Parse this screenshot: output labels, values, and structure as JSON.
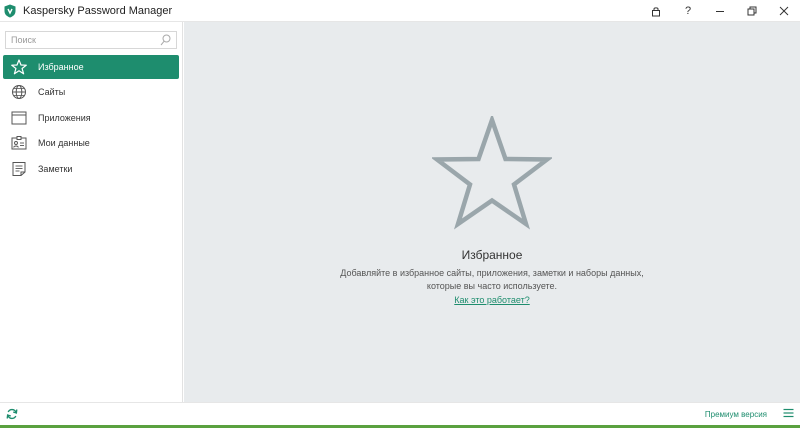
{
  "window": {
    "title": "Kaspersky Password Manager",
    "controls": [
      "lock-icon",
      "help-icon",
      "minimize-icon",
      "restore-icon",
      "close-icon"
    ],
    "help_label": "?"
  },
  "sidebar": {
    "search": {
      "placeholder": "Поиск",
      "value": ""
    },
    "items": [
      {
        "label": "Избранное",
        "icon": "star-icon",
        "active": true
      },
      {
        "label": "Сайты",
        "icon": "globe-icon",
        "active": false
      },
      {
        "label": "Приложения",
        "icon": "window-icon",
        "active": false
      },
      {
        "label": "Мои данные",
        "icon": "id-card-icon",
        "active": false
      },
      {
        "label": "Заметки",
        "icon": "notes-icon",
        "active": false
      }
    ]
  },
  "main": {
    "empty_state": {
      "icon": "star-outline-icon",
      "title": "Избранное",
      "description": "Добавляйте в избранное сайты, приложения, заметки и наборы данных, которые вы часто используете.",
      "link": "Как это работает?"
    }
  },
  "bottom": {
    "sync_icon": "sync-icon",
    "premium_label": "Премиум версия",
    "menu_icon": "menu-icon"
  },
  "colors": {
    "accent": "#1e8d6e",
    "main_bg": "#e8ebed",
    "star_outline": "#9aa6ab"
  }
}
